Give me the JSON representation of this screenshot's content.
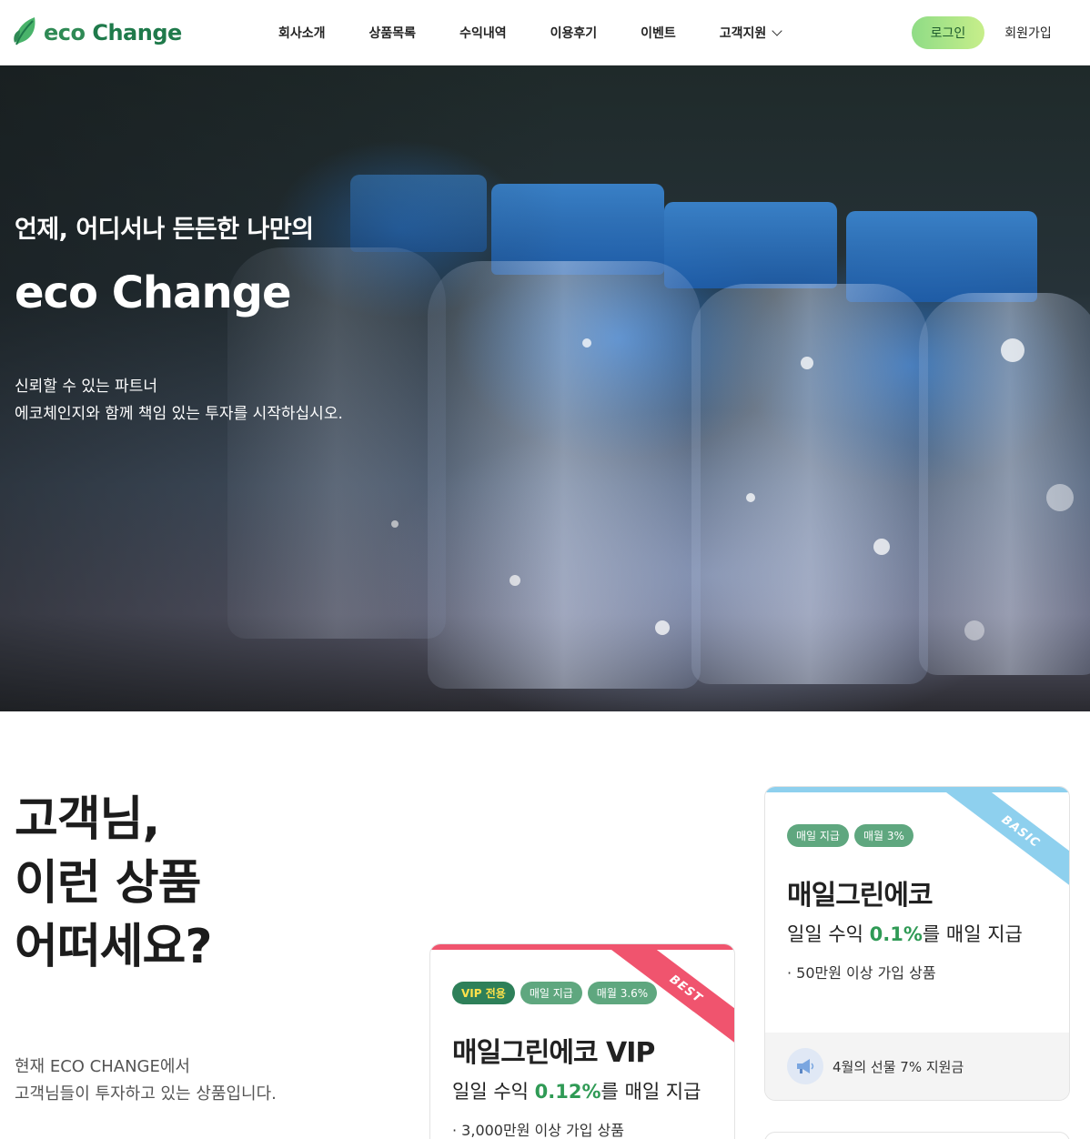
{
  "header": {
    "logo_text_eco": "eco",
    "logo_text_change": "Change",
    "nav": [
      "회사소개",
      "상품목록",
      "수익내역",
      "이용후기",
      "이벤트",
      "고객지원"
    ],
    "login": "로그인",
    "join": "회원가입"
  },
  "hero": {
    "subtitle": "언제, 어디서나 든든한 나만의",
    "title": "eco Change",
    "desc_line1": "신뢰할 수 있는 파트너",
    "desc_line2": "에코체인지와 함께 책임 있는 투자를 시작하십시오."
  },
  "section": {
    "title_line1": "고객님,",
    "title_line2": "이런 상품",
    "title_line3": "어떠세요?",
    "desc_line1": "현재 ECO CHANGE에서",
    "desc_line2": "고객님들이 투자하고 있는 상품입니다."
  },
  "cards": [
    {
      "ribbon": "BEST",
      "tags": [
        "VIP 전용",
        "매일 지급",
        "매월 3.6%"
      ],
      "name": "매일그린에코 VIP",
      "yield_prefix": "일일 수익 ",
      "yield_value": "0.12%",
      "yield_suffix": "를 매일 지급",
      "condition": "· 3,000만원 이상 가입 상품"
    },
    {
      "ribbon": "BASIC",
      "tags": [
        "매일 지급",
        "매월 3%"
      ],
      "name": "매일그린에코",
      "yield_prefix": "일일 수익 ",
      "yield_value": "0.1%",
      "yield_suffix": "를 매일 지급",
      "condition": "· 50만원 이상 가입 상품",
      "footer": "4월의 선물 7% 지원금"
    }
  ],
  "colors": {
    "brand_green": "#2f8a55",
    "highlight_green": "#2f9a55",
    "vip_ribbon": "#f0546e",
    "basic_ribbon": "#8ed0ee"
  },
  "icons": [
    "leaf-logo-icon",
    "chevron-down-icon",
    "megaphone-icon"
  ]
}
